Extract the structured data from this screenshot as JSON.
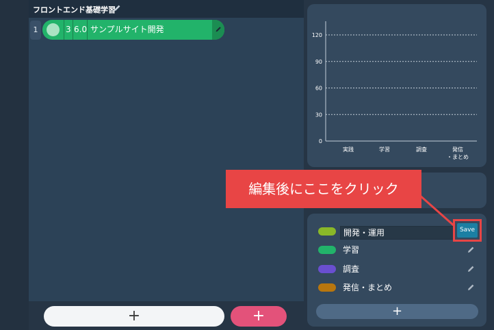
{
  "board": {
    "title": "フロントエンド基礎学習",
    "rows": [
      {
        "number": "1",
        "count": "3",
        "hours": "6.0",
        "name": "サンプルサイト開発",
        "color": "#22b36a"
      }
    ],
    "add_button_label": "+",
    "add_button_pink_label": "+"
  },
  "chart_data": {
    "type": "bar",
    "categories": [
      "実践",
      "学習",
      "調査",
      "発信\n・まとめ"
    ],
    "values": [
      0,
      0,
      0,
      0
    ],
    "ylim": [
      0,
      120
    ],
    "yticks": [
      "0",
      "30",
      "60",
      "90",
      "120"
    ],
    "grid": true
  },
  "categories_panel": {
    "items": [
      {
        "label": "開発・運用",
        "color": "#8ab828",
        "editing": true
      },
      {
        "label": "学習",
        "color": "#22b36a"
      },
      {
        "label": "調査",
        "color": "#6a4fd0"
      },
      {
        "label": "発信・まとめ",
        "color": "#b8760e"
      }
    ],
    "save_label": "Save",
    "add_label": "+"
  },
  "annotation": {
    "text": "編集後にここをクリック",
    "color": "#e84545"
  }
}
